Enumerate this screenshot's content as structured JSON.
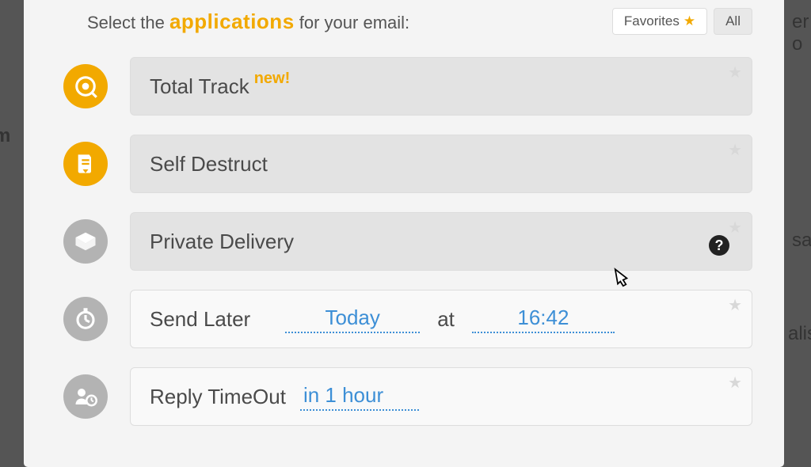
{
  "header": {
    "instruction_prefix": "Select the ",
    "instruction_highlight": "applications",
    "instruction_suffix": " for your email:",
    "favorites_label": "Favorites",
    "all_label": "All"
  },
  "apps": {
    "total_track": {
      "title": "Total Track",
      "badge": "new!"
    },
    "self_destruct": {
      "title": "Self Destruct"
    },
    "private_delivery": {
      "title": "Private Delivery"
    },
    "send_later": {
      "title": "Send Later",
      "date": "Today",
      "at": "at",
      "time": "16:42"
    },
    "reply_timeout": {
      "title": "Reply TimeOut",
      "value": "in 1 hour"
    }
  },
  "bg_snippets": {
    "left_m": "m",
    "right_sa": "sa",
    "right_alis": "alis",
    "right_er": "er o"
  }
}
